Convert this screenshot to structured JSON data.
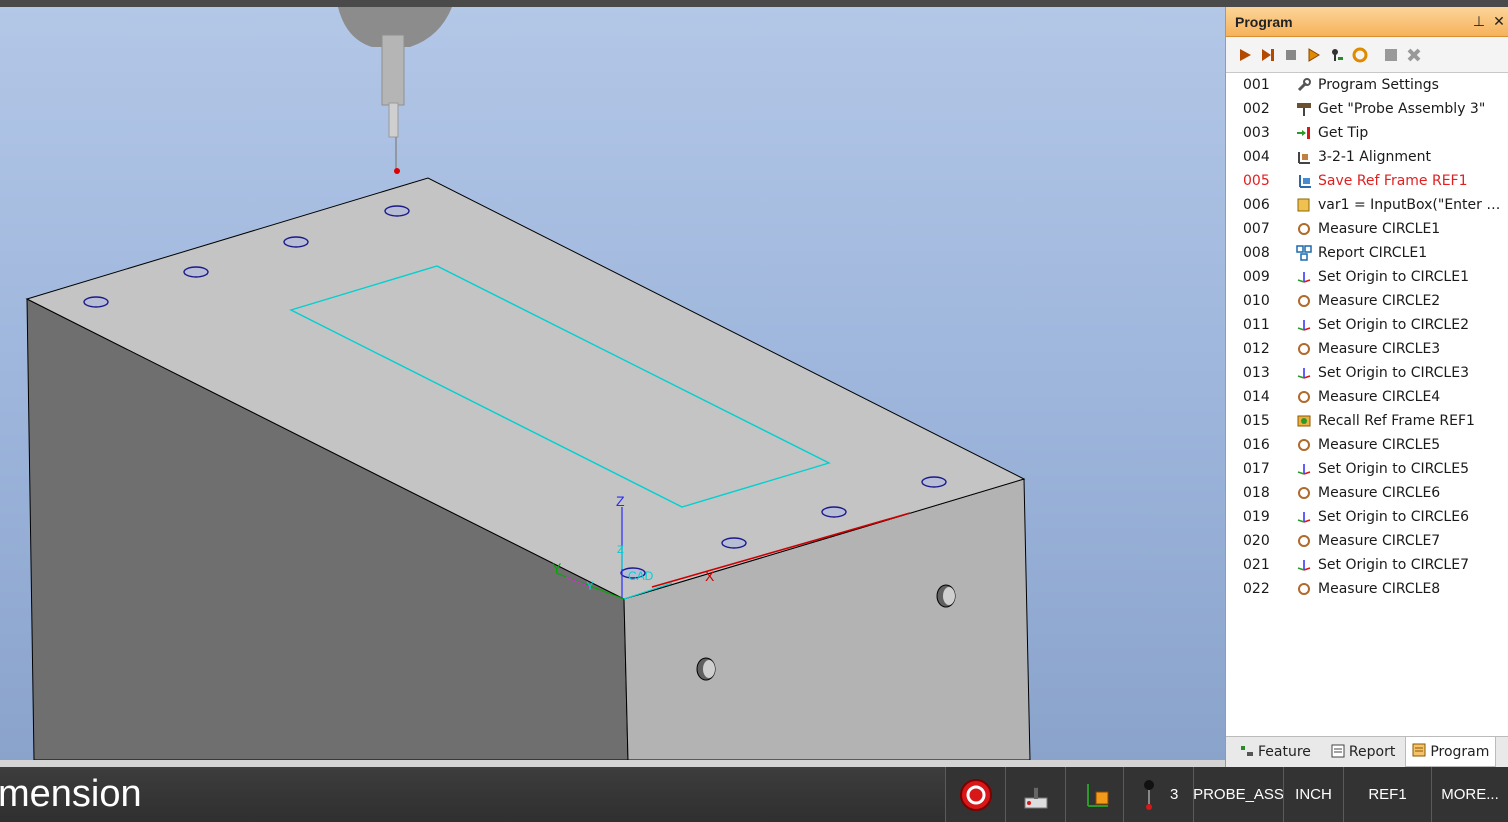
{
  "panel": {
    "title": "Program",
    "pin_icon": "pin-icon",
    "close_icon": "close-icon",
    "toolbar": [
      "run-icon",
      "run-to-end-icon",
      "stop-icon",
      "step-icon",
      "probe-step-icon",
      "refresh-icon",
      "stop-square-icon",
      "delete-icon"
    ],
    "rows": [
      {
        "num": "001",
        "label": "Program Settings",
        "icon": "wrench-icon"
      },
      {
        "num": "002",
        "label": "Get \"Probe Assembly 3\"",
        "icon": "probe-assembly-icon"
      },
      {
        "num": "003",
        "label": "Get Tip",
        "icon": "tip-icon"
      },
      {
        "num": "004",
        "label": "3-2-1 Alignment",
        "icon": "alignment-icon"
      },
      {
        "num": "005",
        "label": "Save Ref Frame REF1",
        "icon": "save-frame-icon",
        "active": true
      },
      {
        "num": "006",
        "label": "var1 = InputBox(\"Enter Offs...",
        "icon": "input-box-icon"
      },
      {
        "num": "007",
        "label": "Measure CIRCLE1",
        "icon": "circle-icon"
      },
      {
        "num": "008",
        "label": "Report CIRCLE1",
        "icon": "report-icon"
      },
      {
        "num": "009",
        "label": "Set Origin to CIRCLE1",
        "icon": "origin-icon"
      },
      {
        "num": "010",
        "label": "Measure CIRCLE2",
        "icon": "circle-icon"
      },
      {
        "num": "011",
        "label": "Set Origin to CIRCLE2",
        "icon": "origin-icon"
      },
      {
        "num": "012",
        "label": "Measure CIRCLE3",
        "icon": "circle-icon"
      },
      {
        "num": "013",
        "label": "Set Origin to CIRCLE3",
        "icon": "origin-icon"
      },
      {
        "num": "014",
        "label": "Measure CIRCLE4",
        "icon": "circle-icon"
      },
      {
        "num": "015",
        "label": "Recall Ref Frame REF1",
        "icon": "recall-frame-icon"
      },
      {
        "num": "016",
        "label": "Measure CIRCLE5",
        "icon": "circle-icon"
      },
      {
        "num": "017",
        "label": "Set Origin to CIRCLE5",
        "icon": "origin-icon"
      },
      {
        "num": "018",
        "label": "Measure CIRCLE6",
        "icon": "circle-icon"
      },
      {
        "num": "019",
        "label": "Set Origin to CIRCLE6",
        "icon": "origin-icon"
      },
      {
        "num": "020",
        "label": "Measure CIRCLE7",
        "icon": "circle-icon"
      },
      {
        "num": "021",
        "label": "Set Origin to CIRCLE7",
        "icon": "origin-icon"
      },
      {
        "num": "022",
        "label": "Measure CIRCLE8",
        "icon": "circle-icon"
      }
    ],
    "tabs": [
      {
        "label": "Feature",
        "icon": "feature-icon"
      },
      {
        "label": "Report",
        "icon": "report-tab-icon"
      },
      {
        "label": "Program",
        "icon": "program-tab-icon",
        "active": true
      }
    ]
  },
  "viewport": {
    "axis_labels": {
      "z": "Z",
      "y": "Y",
      "x": "X",
      "cad": "CAD"
    }
  },
  "status": {
    "prompt": "mension",
    "probe_count": "3",
    "probe": "PROBE_ASS",
    "units": "INCH",
    "frame": "REF1",
    "more": "MORE..."
  },
  "colors": {
    "active_row": "#e02020",
    "panel_header": "#f6b25a",
    "outline": "#00d0d0",
    "x_axis": "#cc0000"
  }
}
